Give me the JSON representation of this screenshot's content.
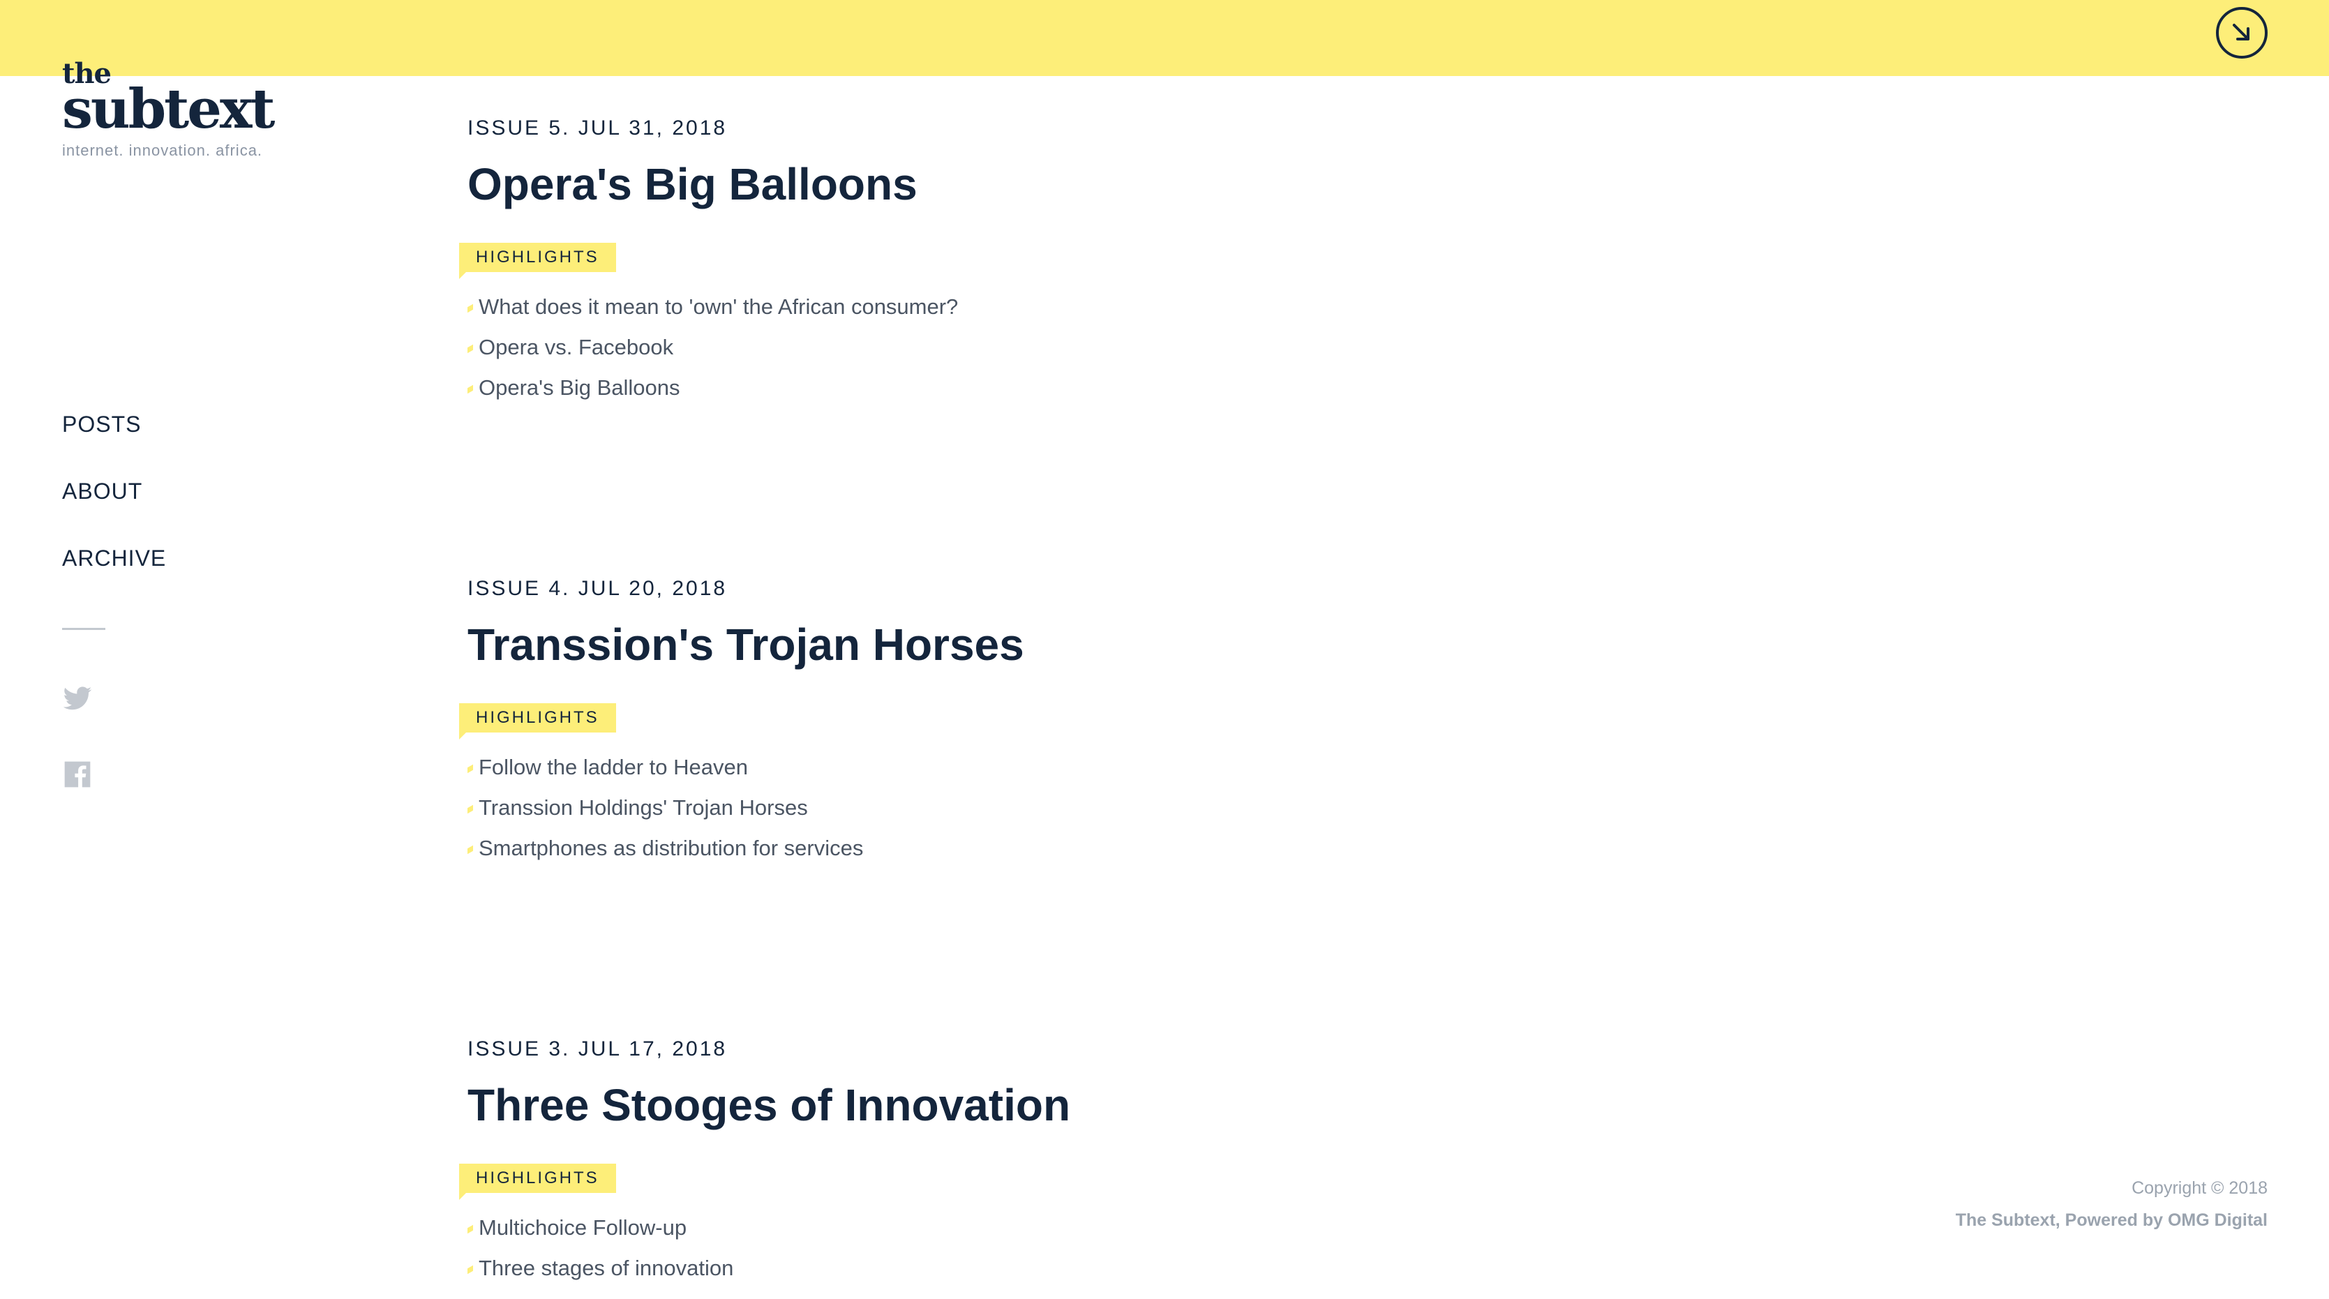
{
  "brand": {
    "logo_the": "the",
    "logo_subtext": "subtext",
    "tagline": "internet. innovation. africa."
  },
  "header": {
    "scroll_icon": "arrow-down-right-icon",
    "background_color": "#fdee79"
  },
  "nav": {
    "items": [
      {
        "label": "POSTS"
      },
      {
        "label": "ABOUT"
      },
      {
        "label": "ARCHIVE"
      }
    ],
    "social": [
      "twitter-icon",
      "facebook-icon"
    ]
  },
  "issues": [
    {
      "meta": "ISSUE 5. JUL 31, 2018",
      "title": "Opera's Big Balloons",
      "tag": "HIGHLIGHTS",
      "highlights": [
        "What does it mean to 'own' the African consumer?",
        "Opera vs. Facebook",
        "Opera's Big Balloons"
      ]
    },
    {
      "meta": "ISSUE 4. JUL 20, 2018",
      "title": "Transsion's Trojan Horses",
      "tag": "HIGHLIGHTS",
      "highlights": [
        "Follow the ladder to Heaven",
        "Transsion Holdings' Trojan Horses",
        "Smartphones as distribution for services"
      ]
    },
    {
      "meta": "ISSUE 3. JUL 17, 2018",
      "title": "Three Stooges of Innovation",
      "tag": "HIGHLIGHTS",
      "highlights": [
        "Multichoice Follow-up",
        "Three stages of innovation"
      ]
    }
  ],
  "footer": {
    "copyright": "Copyright © 2018",
    "powered": "The Subtext, Powered by OMG Digital"
  },
  "colors": {
    "accent": "#fdee79",
    "text": "#14253c",
    "muted": "#9aa3ae"
  }
}
